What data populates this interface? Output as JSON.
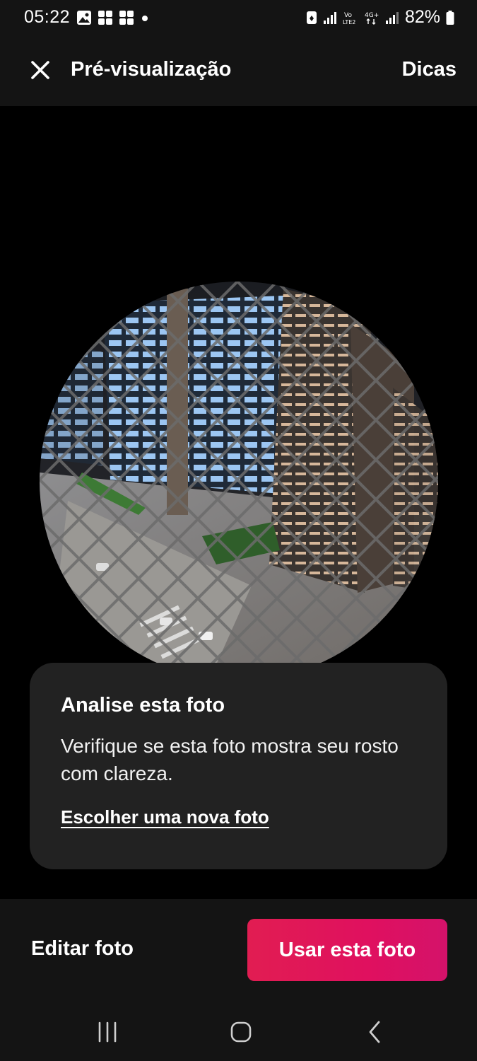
{
  "status_bar": {
    "time": "05:22",
    "battery": "82%",
    "icons": [
      "gallery-icon",
      "grid-app-icon",
      "grid-app-icon",
      "dot-icon",
      "lock-icon",
      "signal-icon",
      "volte-icon",
      "4g-icon",
      "signal-icon",
      "battery-icon"
    ]
  },
  "header": {
    "title": "Pré-visualização",
    "tips_label": "Dicas"
  },
  "card": {
    "title": "Analise esta foto",
    "body": "Verifique se esta foto mostra seu rosto com clareza.",
    "link": "Escolher uma nova foto"
  },
  "actions": {
    "edit_label": "Editar foto",
    "use_label": "Usar esta foto",
    "accent_color": "#E0105F"
  },
  "nav": {
    "icons": [
      "recent-apps-icon",
      "home-icon",
      "back-icon"
    ]
  }
}
